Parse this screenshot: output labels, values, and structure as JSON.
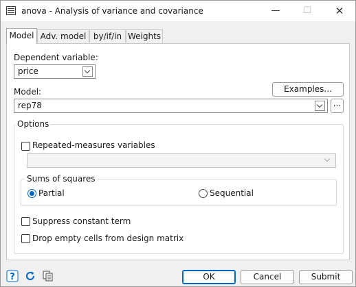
{
  "window": {
    "title": "anova - Analysis of variance and covariance",
    "min_glyph": "—",
    "max_glyph": "☐",
    "close_glyph": "✕"
  },
  "tabs": [
    {
      "label": "Model",
      "active": true
    },
    {
      "label": "Adv. model",
      "active": false
    },
    {
      "label": "by/if/in",
      "active": false
    },
    {
      "label": "Weights",
      "active": false
    }
  ],
  "dependent": {
    "label": "Dependent variable:",
    "value": "price"
  },
  "model": {
    "label": "Model:",
    "value": "rep78",
    "examples_label": "Examples...",
    "browse_label": "..."
  },
  "options": {
    "title": "Options",
    "repeated": {
      "label": "Repeated-measures variables",
      "checked": false,
      "value": ""
    },
    "sums": {
      "title": "Sums of squares",
      "partial": {
        "label": "Partial",
        "selected": true
      },
      "sequential": {
        "label": "Sequential",
        "selected": false
      }
    },
    "suppress": {
      "label": "Suppress constant term",
      "checked": false
    },
    "drop_empty": {
      "label": "Drop empty cells from design matrix",
      "checked": false
    }
  },
  "footer": {
    "ok_label": "OK",
    "cancel_label": "Cancel",
    "submit_label": "Submit"
  },
  "colors": {
    "accent": "#0067c0",
    "background": "#f0f0f0",
    "panel": "#ffffff"
  },
  "icons": [
    "help-icon",
    "reset-icon",
    "copy-command-icon"
  ]
}
